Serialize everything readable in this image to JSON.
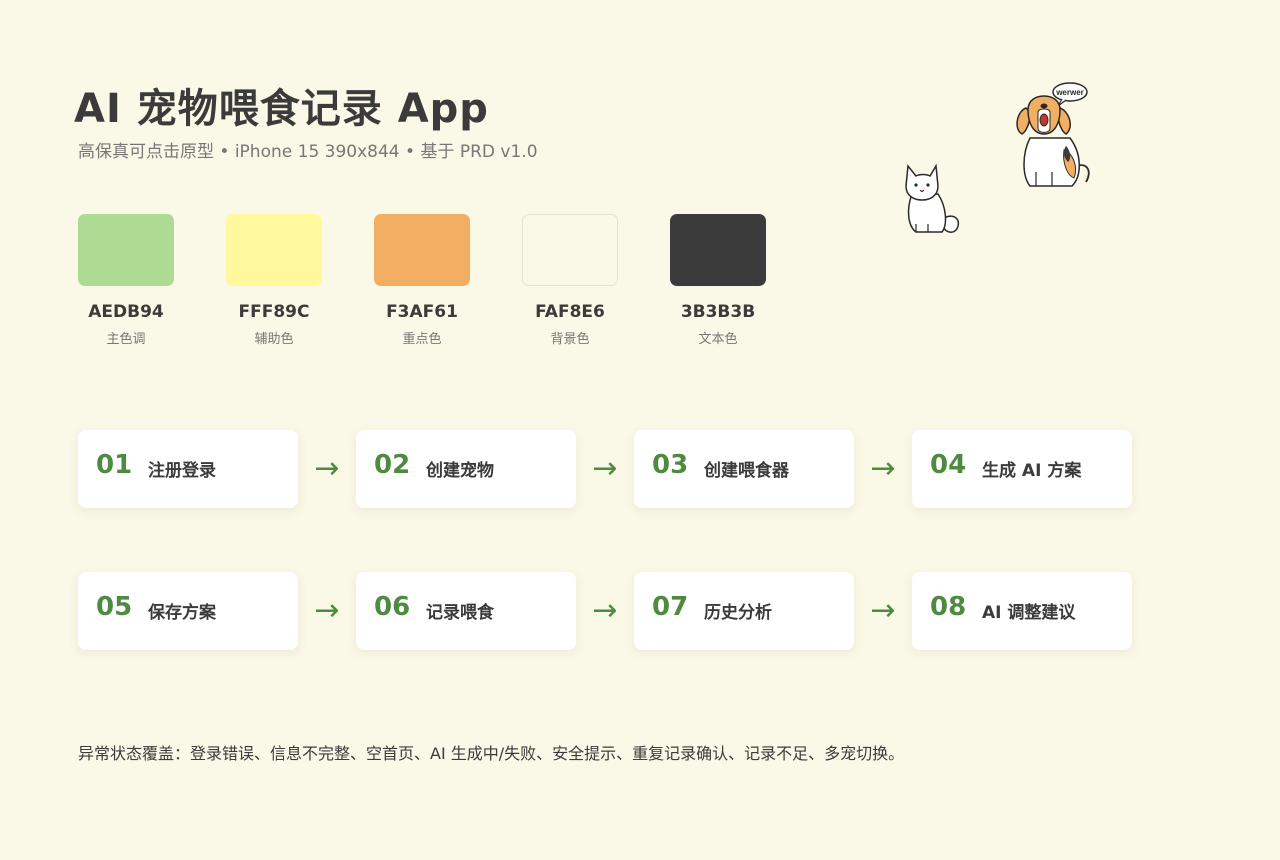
{
  "header": {
    "title": "AI 宠物喂食记录 App",
    "subtitle": "高保真可点击原型 • iPhone 15 390x844 • 基于 PRD v1.0"
  },
  "palette": [
    {
      "hex": "AEDB94",
      "name": "主色调",
      "color": "#AEDB94"
    },
    {
      "hex": "FFF89C",
      "name": "辅助色",
      "color": "#FFF89C"
    },
    {
      "hex": "F3AF61",
      "name": "重点色",
      "color": "#F3AF61"
    },
    {
      "hex": "FAF8E6",
      "name": "背景色",
      "color": "#FAF8E6"
    },
    {
      "hex": "3B3B3B",
      "name": "文本色",
      "color": "#3B3B3B"
    }
  ],
  "flow": [
    {
      "num": "01",
      "label": "注册登录"
    },
    {
      "num": "02",
      "label": "创建宠物"
    },
    {
      "num": "03",
      "label": "创建喂食器"
    },
    {
      "num": "04",
      "label": "生成 AI 方案"
    },
    {
      "num": "05",
      "label": "保存方案"
    },
    {
      "num": "06",
      "label": "记录喂食"
    },
    {
      "num": "07",
      "label": "历史分析"
    },
    {
      "num": "08",
      "label": "AI 调整建议"
    }
  ],
  "flow_arrow": "→",
  "footnote": "异常状态覆盖：登录错误、信息不完整、空首页、AI 生成中/失败、安全提示、重复记录确认、记录不足、多宠切换。",
  "illustration": {
    "speech_bubble": "werwer"
  },
  "colors": {
    "accent_green": "#4F8A41",
    "background": "#FAF8E6",
    "text": "#3B3B3B",
    "dog_orange": "#F3AF61"
  }
}
